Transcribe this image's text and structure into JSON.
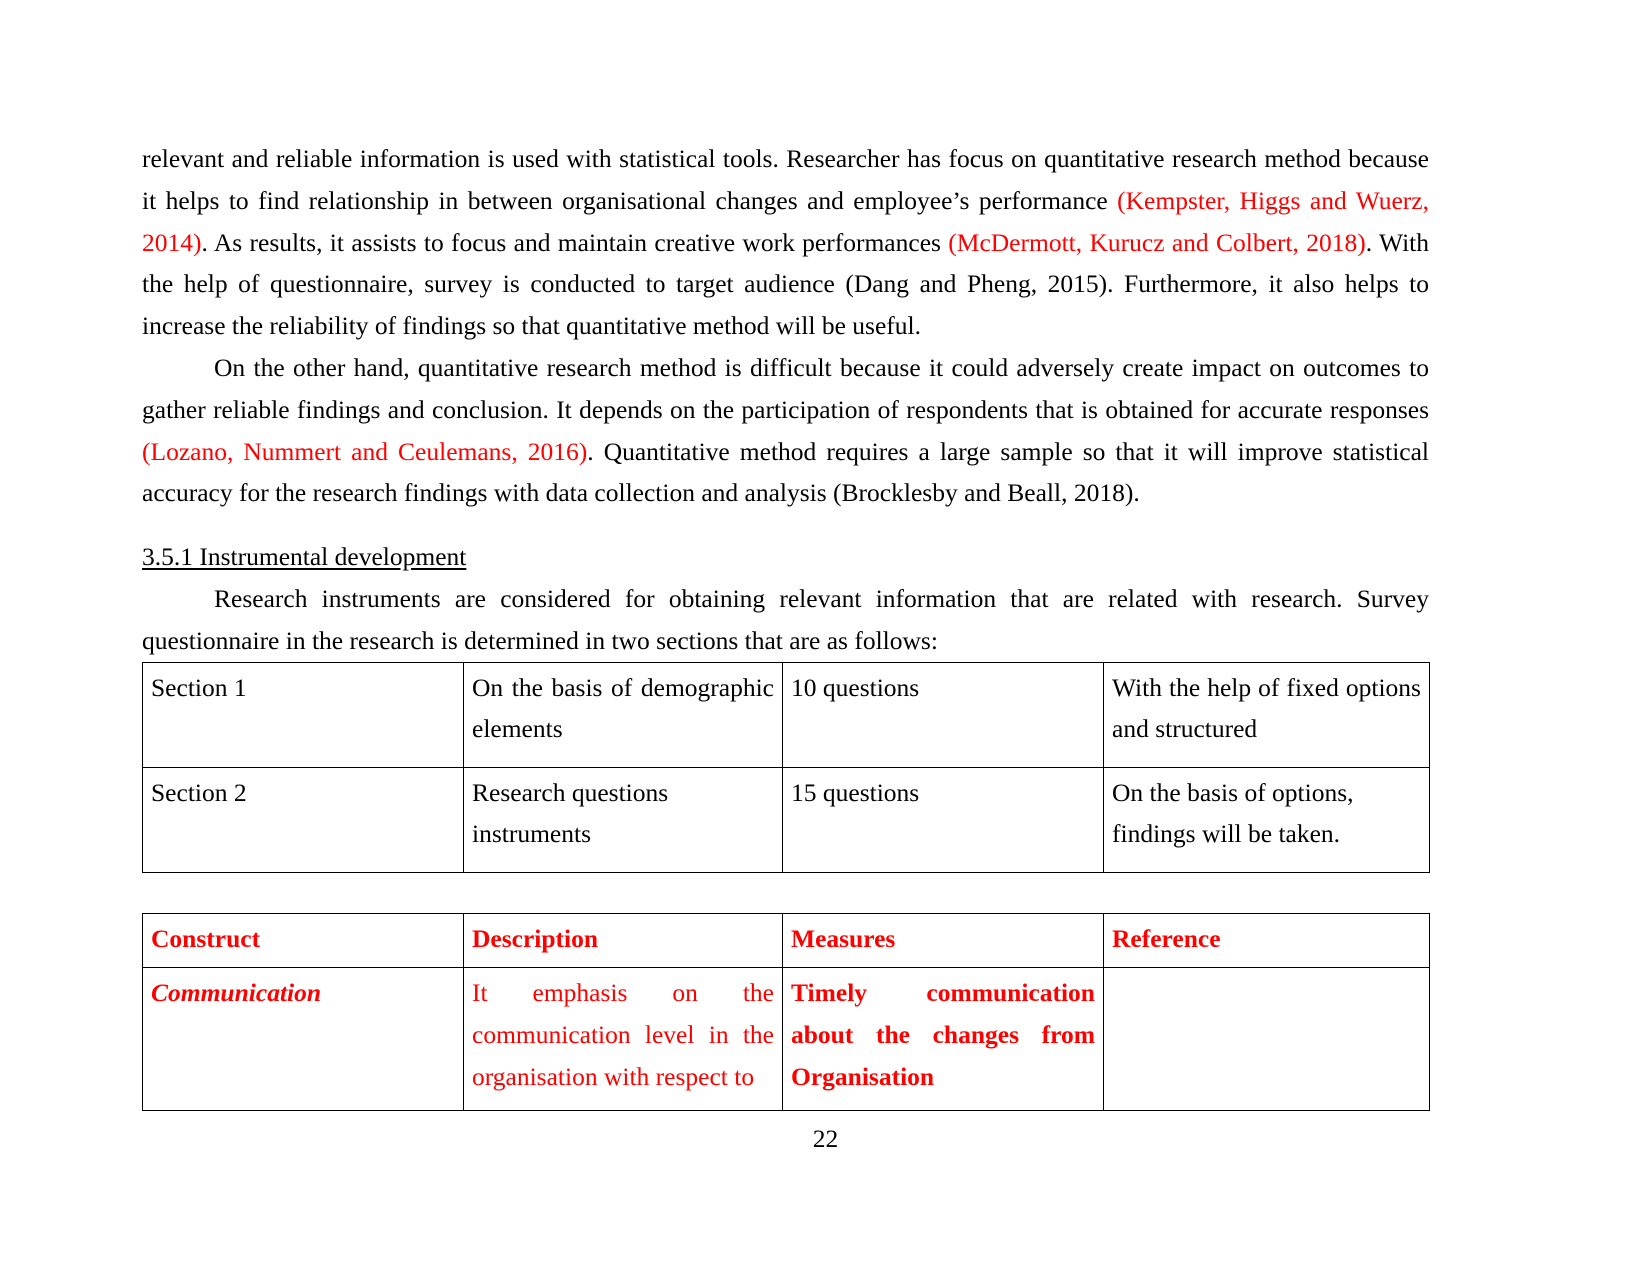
{
  "document": {
    "page_number": "22",
    "accent_color": "#ff0000",
    "text_color": "#000000"
  },
  "paragraphs": {
    "p1_seg1": "relevant and reliable information is used with statistical tools. Researcher has focus on quantitative research method because it helps to find relationship in between organisational changes and employee’s performance ",
    "p1_cite1": "(Kempster, Higgs and Wuerz, 2014)",
    "p1_seg2": ". As results, it assists to focus and maintain creative work performances ",
    "p1_cite2": "(McDermott, Kurucz and Colbert, 2018)",
    "p1_seg3": ". With the help of questionnaire, survey is conducted to target audience (Dang and Pheng, 2015). Furthermore, it also helps to increase the reliability of findings so that quantitative method will be useful.",
    "p2_seg1": "On the other hand, quantitative research method is difficult because it could adversely create impact on outcomes to gather reliable findings and conclusion. It depends on the participation of respondents that is obtained for accurate responses ",
    "p2_cite1": "(Lozano, Nummert and Ceulemans, 2016)",
    "p2_seg2": ". Quantitative method requires a large sample so that it will improve statistical accuracy for the research findings with data collection and analysis (Brocklesby and Beall, 2018).",
    "p3": "Research instruments are considered for obtaining relevant information that are related with research. Survey questionnaire in the research is determined in two sections that are as follows:"
  },
  "heading": {
    "section_3_5_1": "3.5.1 Instrumental development"
  },
  "sections_table": {
    "rows": [
      {
        "section": "Section 1",
        "basis": "On the basis of demographic elements",
        "questions": "10 questions",
        "notes": "With the help of fixed options and structured"
      },
      {
        "section": "Section 2",
        "basis": "Research questions instruments",
        "questions": "15 questions",
        "notes": "On the basis of options, findings will be taken."
      }
    ]
  },
  "construct_table": {
    "headers": {
      "construct": "Construct",
      "description": "Description",
      "measures": "Measures",
      "reference": "Reference"
    },
    "rows": [
      {
        "construct": "Communication",
        "description": "It emphasis on the communication level in the organisation with respect to",
        "measures": "Timely communication about the changes from Organisation",
        "reference": ""
      }
    ]
  }
}
